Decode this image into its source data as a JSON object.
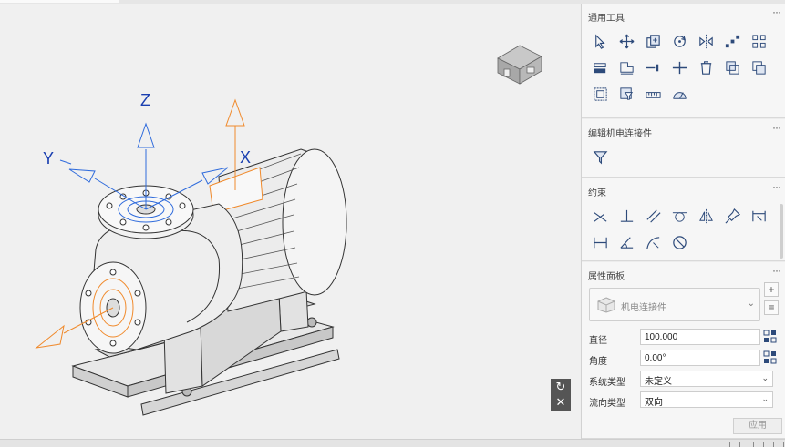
{
  "panels": {
    "general_tools": {
      "title": "通用工具",
      "more": "···"
    },
    "edit_connector": {
      "title": "编辑机电连接件",
      "more": "···"
    },
    "constraints": {
      "title": "约束",
      "more": "···"
    },
    "properties": {
      "title": "属性面板",
      "more": "···",
      "type_selector": {
        "value": "机电连接件",
        "icon": "cube-icon"
      },
      "add_button": "+",
      "list_button": "≡",
      "fields": [
        {
          "label": "直径",
          "value": "100.000",
          "kind": "input"
        },
        {
          "label": "角度",
          "value": "0.00°",
          "kind": "input"
        },
        {
          "label": "系统类型",
          "value": "未定义",
          "kind": "select"
        },
        {
          "label": "流向类型",
          "value": "双向",
          "kind": "select"
        }
      ],
      "apply_label": "应用"
    }
  },
  "viewport": {
    "axes": {
      "z": "Z",
      "y": "Y",
      "x": "X"
    },
    "view_cube_icon": "house-view-cube",
    "side_buttons": {
      "reset": "↻",
      "close": "✕"
    }
  },
  "colors": {
    "axis_blue": "#1a3fb0",
    "orange_arrow": "#f08a2c",
    "panel_bg": "#f6f6f6",
    "viewport_bg": "#f0f0f0"
  }
}
